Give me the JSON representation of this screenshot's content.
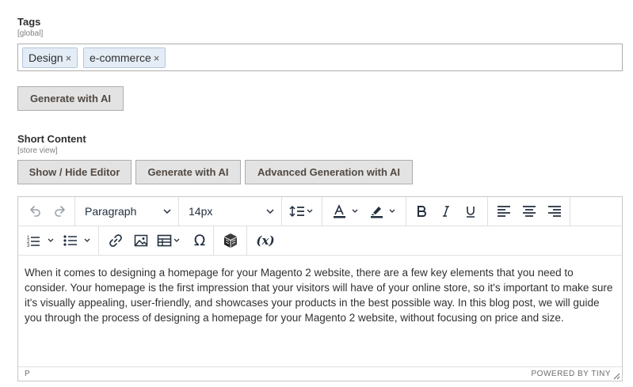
{
  "tags_field": {
    "label": "Tags",
    "scope": "[global]",
    "tags": [
      {
        "text": "Design",
        "remove": "×"
      },
      {
        "text": "e-commerce",
        "remove": "×"
      }
    ],
    "generate_button": "Generate with AI"
  },
  "short_content": {
    "label": "Short Content",
    "scope": "[store view]",
    "buttons": {
      "toggle_editor": "Show / Hide Editor",
      "generate": "Generate with AI",
      "advanced": "Advanced Generation with AI"
    }
  },
  "editor": {
    "block_format": "Paragraph",
    "font_size": "14px",
    "variables_label": "(x)",
    "omega_label": "Ω",
    "content": "When it comes to designing a homepage for your Magento 2 website, there are a few key elements that you need to consider. Your homepage is the first impression that your visitors will have of your online store, so it's important to make sure it's visually appealing, user-friendly, and showcases your products in the best possible way. In this blog post, we will guide you through the process of designing a homepage for your Magento 2 website, without focusing on price and size.",
    "status_path": "P",
    "branding": "POWERED BY TINY"
  },
  "colors": {
    "text_color_bar": "#222f3e",
    "highlight_bar": "#222f3e",
    "tag_bg": "#e4ecf5",
    "button_bg": "#e3e3e3"
  },
  "icons": [
    "undo-icon",
    "redo-icon",
    "line-height-icon",
    "text-color-icon",
    "highlight-icon",
    "bold-icon",
    "italic-icon",
    "underline-icon",
    "align-left-icon",
    "align-center-icon",
    "align-right-icon",
    "numbered-list-icon",
    "bullet-list-icon",
    "link-icon",
    "image-icon",
    "table-icon",
    "special-char-icon",
    "widget-icon",
    "variable-icon"
  ]
}
